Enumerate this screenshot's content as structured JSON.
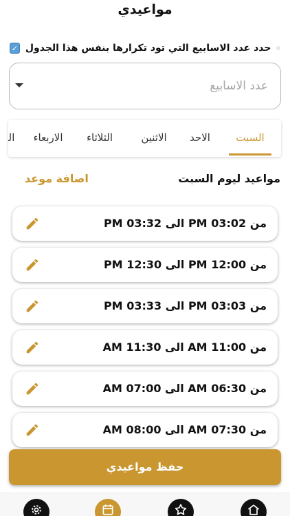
{
  "header": {
    "title": "مواعيدي"
  },
  "weeks": {
    "label": "حدد عدد الاسابيع التي تود تكرارها بنفس هذا الجدول",
    "placeholder": "عدد الاسابيع"
  },
  "tabs": [
    {
      "label": "السبت",
      "active": true
    },
    {
      "label": "الاحد",
      "active": false
    },
    {
      "label": "الاثنين",
      "active": false
    },
    {
      "label": "الثلاثاء",
      "active": false
    },
    {
      "label": "الاربعاء",
      "active": false
    },
    {
      "label": "الخميس",
      "active": false
    }
  ],
  "day": {
    "title": "مواعيد ليوم السبت",
    "add_label": "اضافة موعد"
  },
  "slots": [
    {
      "text": "من 03:02 PM  الى 03:32 PM"
    },
    {
      "text": "من 12:00 PM  الى 12:30 PM"
    },
    {
      "text": "من 03:03 PM  الى 03:33 PM"
    },
    {
      "text": "من 11:00 AM  الى 11:30 AM"
    },
    {
      "text": "من 06:30 AM  الى 07:00 AM"
    },
    {
      "text": "من 07:30 AM  الى 08:00 AM"
    }
  ],
  "save_label": "حفظ مواعيدي",
  "nav": [
    {
      "icon": "settings-icon",
      "active": false
    },
    {
      "icon": "calendar-icon",
      "active": true
    },
    {
      "icon": "star-icon",
      "active": false
    },
    {
      "icon": "home-icon",
      "active": false
    }
  ],
  "colors": {
    "accent": "#c9962f",
    "text": "#111111",
    "placeholder": "#a6a6a6"
  }
}
